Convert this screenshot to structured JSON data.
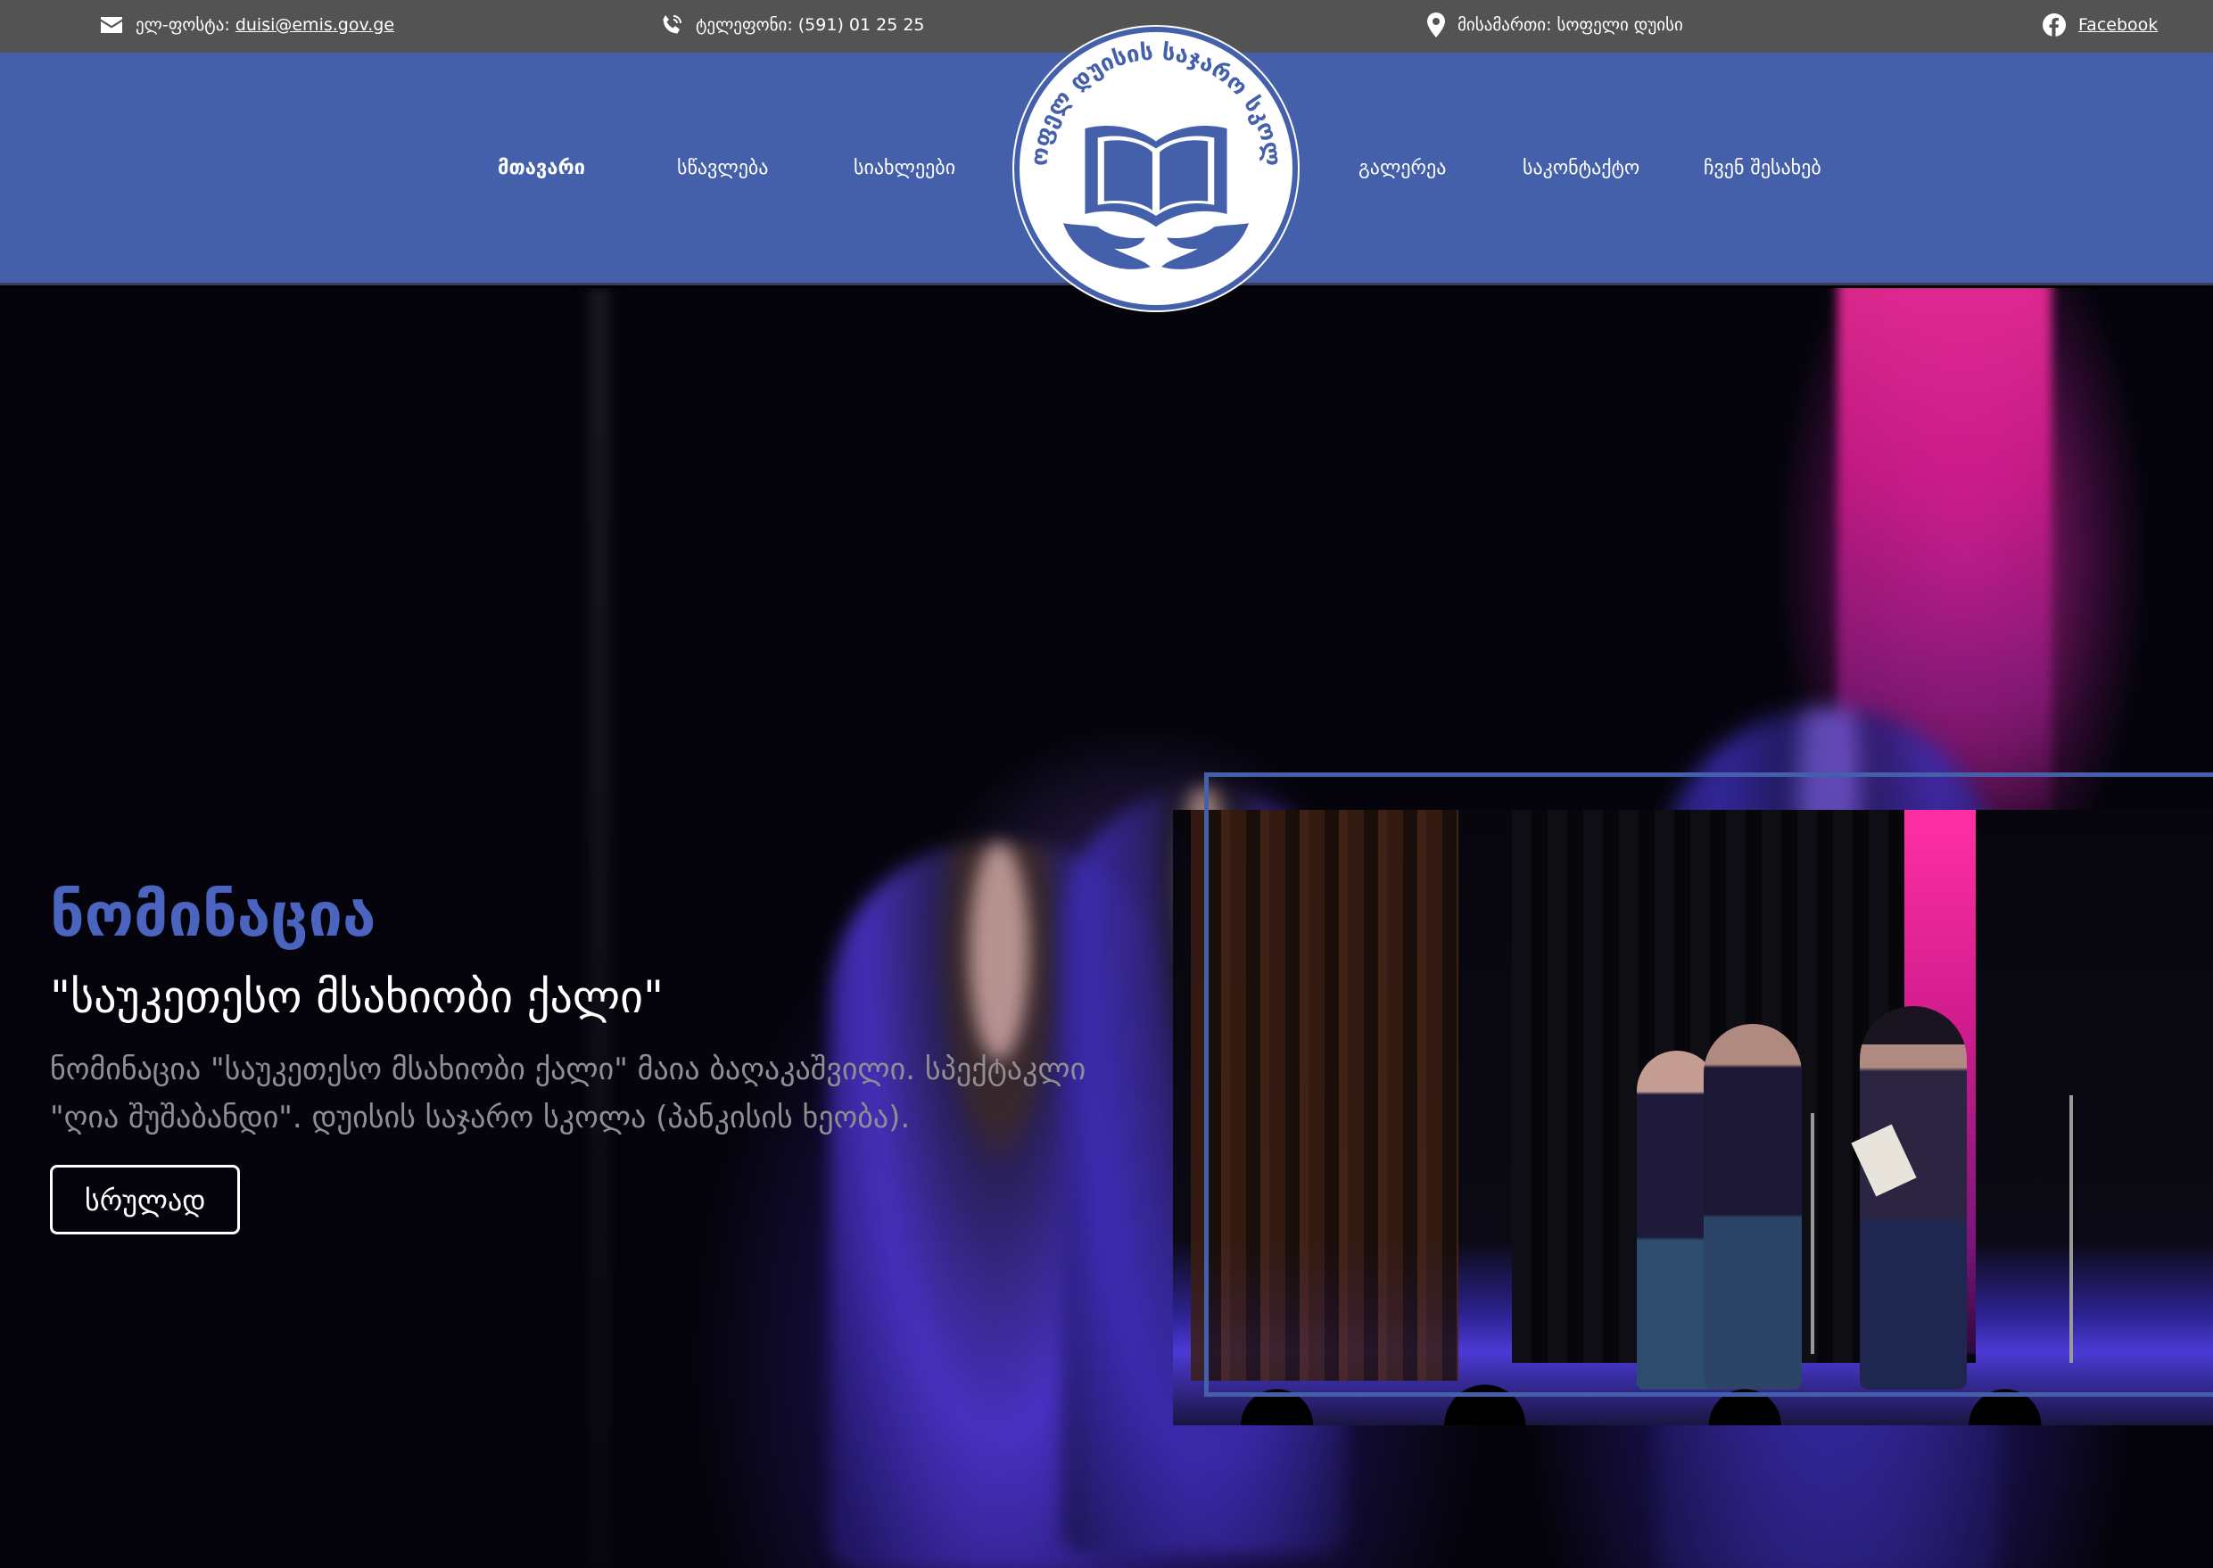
{
  "topbar": {
    "email_label": "ელ-ფოსტა:",
    "email_value": "duisi@emis.gov.ge",
    "phone_label": "ტელეფონი: (591) 01 25 25",
    "address_label": "მისამართი: სოფელი დუისი",
    "facebook_label": "Facebook",
    "icons": [
      "envelope-icon",
      "phone-icon",
      "map-pin-icon",
      "facebook-icon"
    ]
  },
  "nav": {
    "left": [
      {
        "label": "მთავარი",
        "active": true
      },
      {
        "label": "სწავლება",
        "active": false
      },
      {
        "label": "სიახლეები",
        "active": false
      }
    ],
    "right": [
      {
        "label": "გალერეა",
        "active": false
      },
      {
        "label": "საკონტაქტო",
        "active": false
      },
      {
        "label": "ჩვენ შესახებ",
        "active": false
      }
    ]
  },
  "logo": {
    "ring_text": "სოფელ დუისის საჯარო სკოლა",
    "icon": "open-book-hands-icon"
  },
  "hero": {
    "title": "ნომინაცია",
    "subtitle": "\"საუკეთესო მსახიობი ქალი\"",
    "description": "ნომინაცია \"საუკეთესო მსახიობი ქალი\" მაია ბაღაკაშვილი. სპექტაკლი \"ღია შუშაბანდი\". დუისის საჯარო სკოლა (პანკისის ხეობა).",
    "button_label": "სრულად"
  },
  "colors": {
    "topbar_bg": "#535353",
    "nav_bg": "#4560ab",
    "accent": "#4a64c0",
    "text_muted": "#8e8e93"
  }
}
